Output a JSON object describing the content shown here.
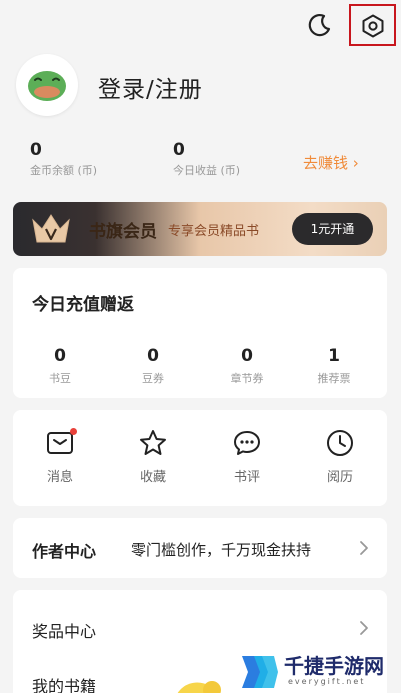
{
  "profile": {
    "login_label": "登录/注册"
  },
  "stats": {
    "coins": {
      "value": "0",
      "label": "金币余额 (币)"
    },
    "earnings": {
      "value": "0",
      "label": "今日收益 (币)"
    },
    "earn_link": "去赚钱 ›"
  },
  "vip": {
    "title": "书旗会员",
    "subtitle": "专享会员精品书",
    "button": "1元开通"
  },
  "recharge": {
    "title": "今日充值赠返",
    "items": [
      {
        "value": "0",
        "label": "书豆"
      },
      {
        "value": "0",
        "label": "豆券"
      },
      {
        "value": "0",
        "label": "章节券"
      },
      {
        "value": "1",
        "label": "推荐票"
      }
    ]
  },
  "actions": [
    {
      "label": "消息",
      "icon": "mail-icon"
    },
    {
      "label": "收藏",
      "icon": "star-icon"
    },
    {
      "label": "书评",
      "icon": "comment-icon"
    },
    {
      "label": "阅历",
      "icon": "clock-icon"
    }
  ],
  "author": {
    "title": "作者中心",
    "desc": "零门槛创作，千万现金扶持"
  },
  "menu": [
    {
      "label": "奖品中心"
    },
    {
      "label": "我的书籍"
    }
  ],
  "watermark": {
    "title": "千捷手游网",
    "url": "everygift.net"
  },
  "colors": {
    "accent": "#f08b3a",
    "settings_highlight": "#c8161d",
    "notification_dot": "#e8413a"
  }
}
